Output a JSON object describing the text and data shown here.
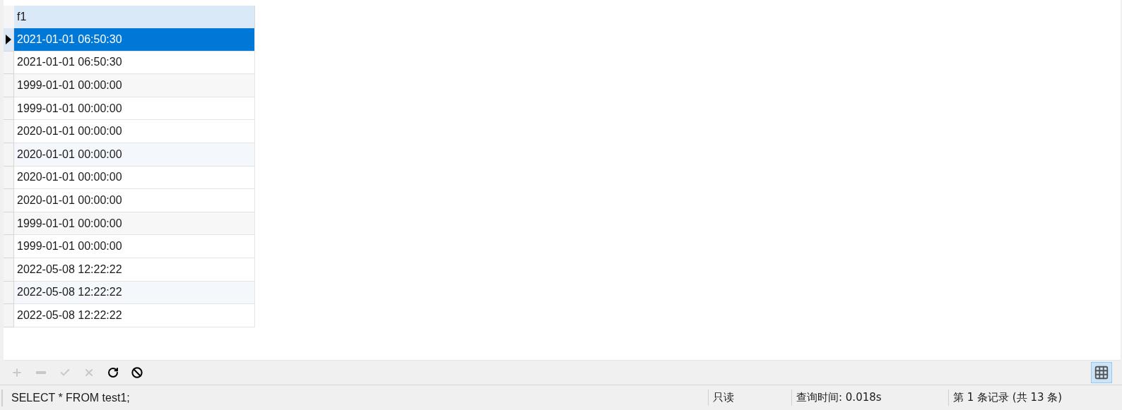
{
  "grid": {
    "columns": [
      "f1"
    ],
    "rows": [
      {
        "value": "2021-01-01 06:50:30",
        "selected": true
      },
      {
        "value": "2021-01-01 06:50:30",
        "selected": false
      },
      {
        "value": "1999-01-01 00:00:00",
        "selected": false
      },
      {
        "value": "1999-01-01 00:00:00",
        "selected": false
      },
      {
        "value": "2020-01-01 00:00:00",
        "selected": false
      },
      {
        "value": "2020-01-01 00:00:00",
        "selected": false
      },
      {
        "value": "2020-01-01 00:00:00",
        "selected": false
      },
      {
        "value": "2020-01-01 00:00:00",
        "selected": false
      },
      {
        "value": "1999-01-01 00:00:00",
        "selected": false
      },
      {
        "value": "1999-01-01 00:00:00",
        "selected": false
      },
      {
        "value": "2022-05-08 12:22:22",
        "selected": false
      },
      {
        "value": "2022-05-08 12:22:22",
        "selected": false
      },
      {
        "value": "2022-05-08 12:22:22",
        "selected": false
      }
    ]
  },
  "toolbar": {
    "buttons": [
      {
        "kind": "add",
        "disabled": true
      },
      {
        "kind": "delete",
        "disabled": true
      },
      {
        "kind": "apply",
        "disabled": true
      },
      {
        "kind": "discard",
        "disabled": true
      },
      {
        "kind": "refresh",
        "disabled": false
      },
      {
        "kind": "stop",
        "disabled": false
      }
    ],
    "grid_view": {
      "selected": true
    }
  },
  "status_bar": {
    "query": "SELECT * FROM test1;",
    "mode": "只读",
    "query_time": "查询时间: 0.018s",
    "record": "第 1 条记录 (共 13 条)"
  }
}
